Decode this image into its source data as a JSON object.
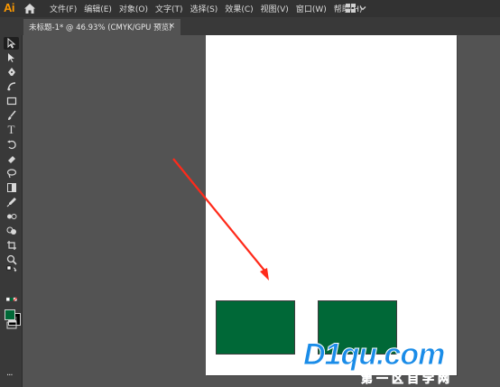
{
  "app": {
    "logo_text": "Ai",
    "home_icon": "home-icon"
  },
  "menu": {
    "items": [
      "文件(F)",
      "编辑(E)",
      "对象(O)",
      "文字(T)",
      "选择(S)",
      "效果(C)",
      "视图(V)",
      "窗口(W)",
      "帮助(H)"
    ]
  },
  "workspace": {
    "icon": "workspace-grid-icon",
    "chevron": "chevron-down-icon"
  },
  "tabs": {
    "document_label": "未标题-1* @ 46.93% (CMYK/GPU 预览)",
    "close_label": "×",
    "grip_label": "»"
  },
  "toolbar": {
    "type_tool_label": "T",
    "more_label": "···",
    "fill_color": "#006837",
    "stroke_color": "#000000"
  },
  "canvas": {
    "artboard_color": "#ffffff",
    "rect_fill": "#006837",
    "arrow_color": "#ff2a1a"
  },
  "watermark": {
    "main_text": "D1qu.com",
    "sub_text": "第一区自学网",
    "color": "#1a8ce8"
  }
}
